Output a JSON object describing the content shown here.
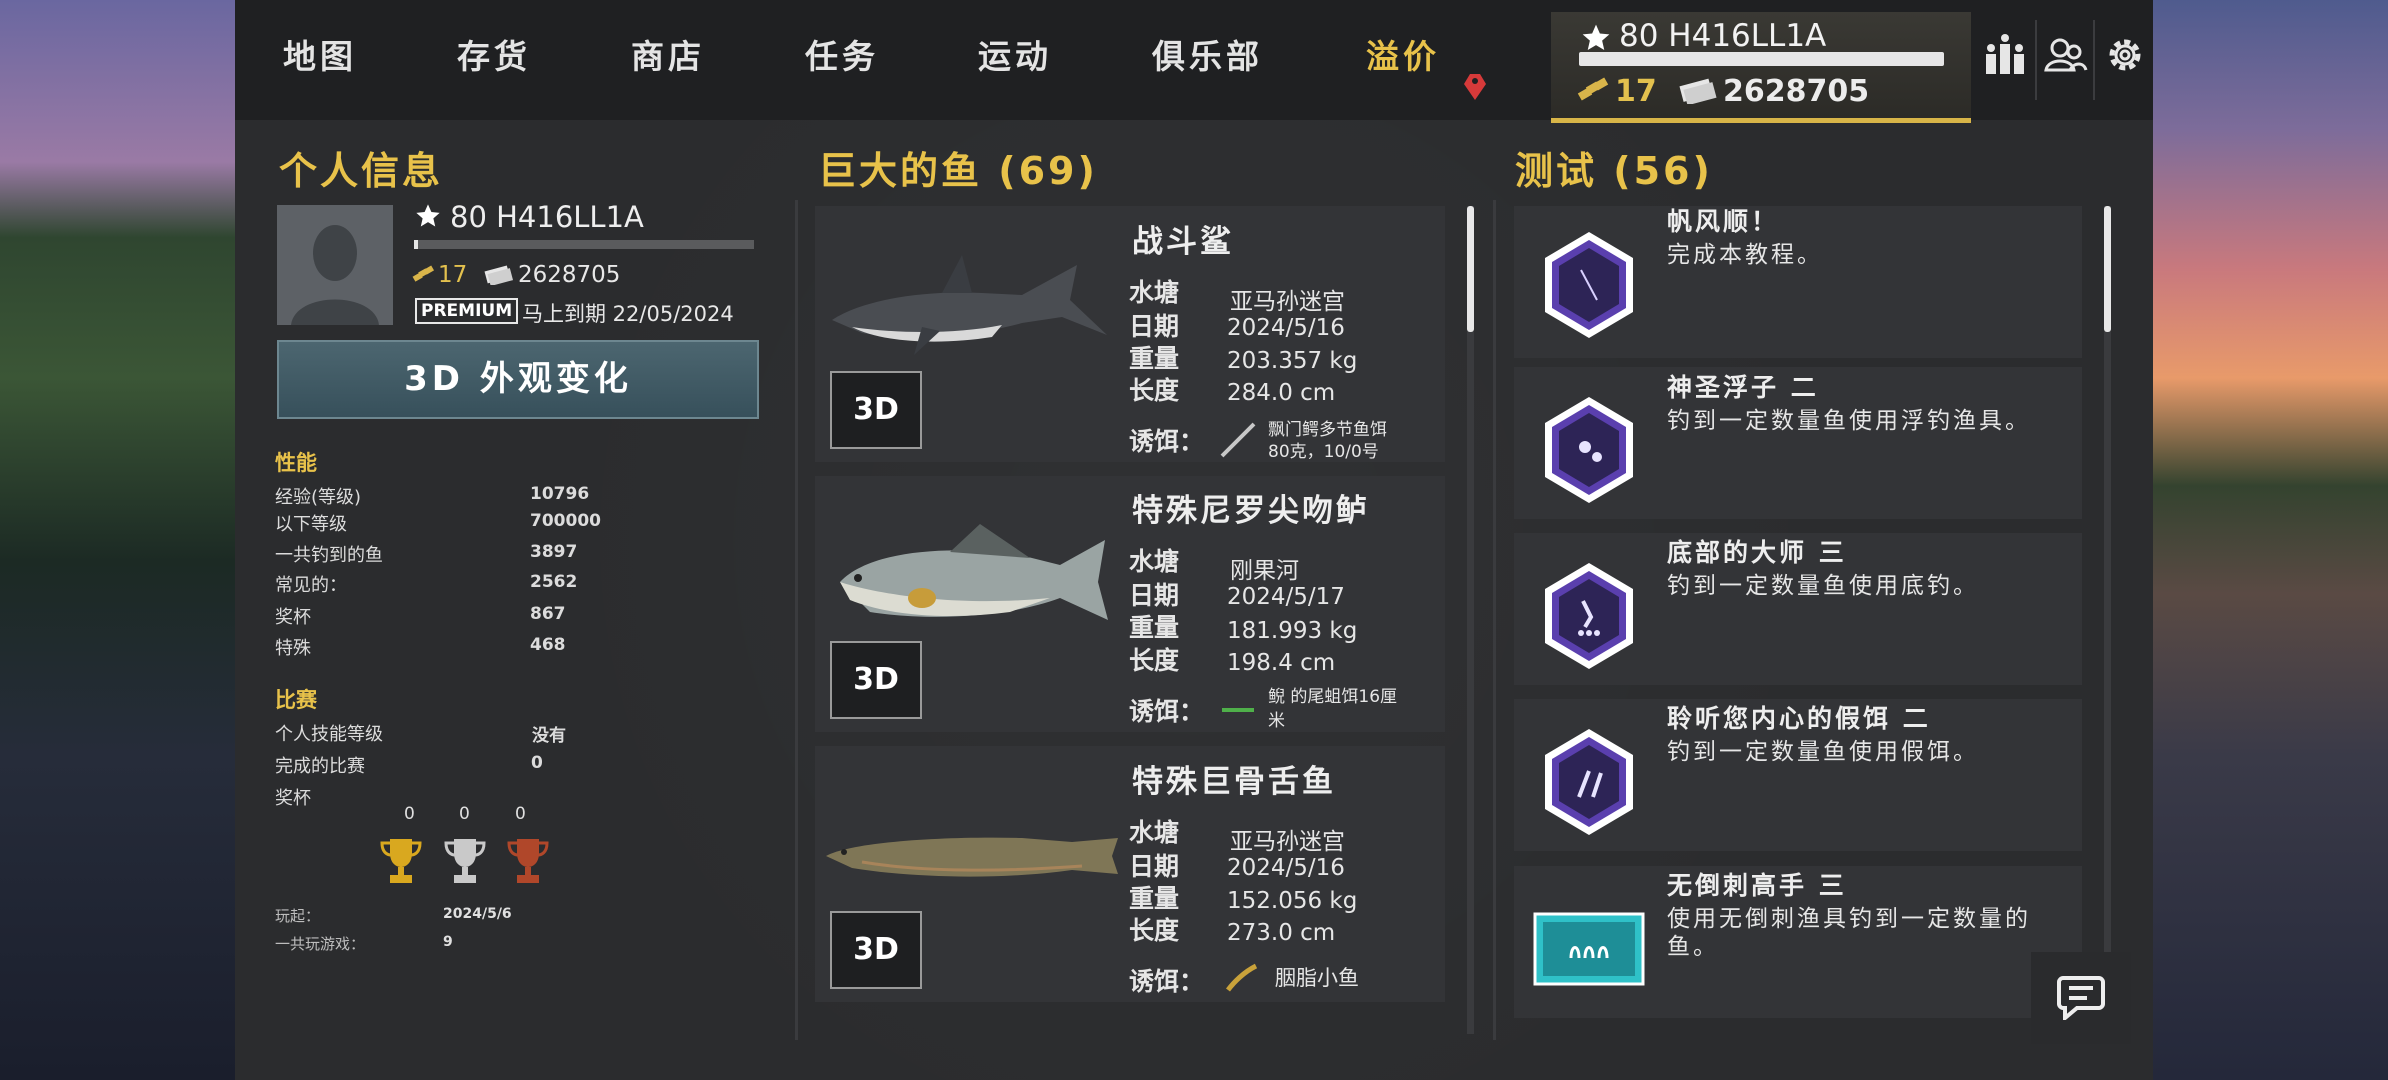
{
  "nav": {
    "items": [
      {
        "label": "地图"
      },
      {
        "label": "存货"
      },
      {
        "label": "商店"
      },
      {
        "label": "任务"
      },
      {
        "label": "运动"
      },
      {
        "label": "俱乐部"
      },
      {
        "label": "溢价",
        "active": true
      }
    ],
    "accent": "#e8c24a"
  },
  "player": {
    "level_name": "80 H416LL1A",
    "gold": "17",
    "cash": "2628705",
    "premium_badge": "PREMIUM",
    "premium_expiry": "马上到期 22/05/2024",
    "appearance_button": "3D 外观变化"
  },
  "profile": {
    "title": "个人信息",
    "performance_title": "性能",
    "stats": [
      {
        "label": "经验(等级)",
        "value": "10796"
      },
      {
        "label": "以下等级",
        "value": "700000"
      },
      {
        "label": "一共钓到的鱼",
        "value": "3897"
      },
      {
        "label": "常见的：",
        "value": "2562"
      },
      {
        "label": "奖杯",
        "value": "867"
      },
      {
        "label": "特殊",
        "value": "468"
      }
    ],
    "competition_title": "比赛",
    "competition": [
      {
        "label": "个人技能等级",
        "value": "没有"
      },
      {
        "label": "完成的比赛",
        "value": "0"
      },
      {
        "label": "奖杯",
        "value": ""
      }
    ],
    "trophies": [
      {
        "count": "0",
        "color": "#d9a81f",
        "icon": "gold-trophy-icon"
      },
      {
        "count": "0",
        "color": "#c9c9c9",
        "icon": "silver-trophy-icon"
      },
      {
        "count": "0",
        "color": "#b0472a",
        "icon": "bronze-trophy-icon"
      }
    ],
    "footer": [
      {
        "label": "玩起：",
        "value": "2024/5/6"
      },
      {
        "label": "一共玩游戏：",
        "value": "9"
      }
    ]
  },
  "fish": {
    "title": "巨大的鱼 (69)",
    "labels": {
      "pond": "水塘",
      "date": "日期",
      "weight": "重量",
      "length": "长度",
      "lure": "诱饵："
    },
    "button_3d": "3D",
    "items": [
      {
        "name": "战斗鲨",
        "pond": "亚马孙迷宫",
        "date": "2024/5/16",
        "weight": "203.357 kg",
        "length": "284.0 cm",
        "lure_line1": "飘门鳄多节鱼饵",
        "lure_line2": "80克，10/0号"
      },
      {
        "name": "特殊尼罗尖吻鲈",
        "pond": "刚果河",
        "date": "2024/5/17",
        "weight": "181.993 kg",
        "length": "198.4 cm",
        "lure_line1": "鲵 的尾蛆饵16厘",
        "lure_line2": "米"
      },
      {
        "name": "特殊巨骨舌鱼",
        "pond": "亚马孙迷宫",
        "date": "2024/5/16",
        "weight": "152.056 kg",
        "length": "273.0 cm",
        "lure_line1": "胭脂小鱼",
        "lure_line2": ""
      }
    ]
  },
  "tests": {
    "title": "测试 (56)",
    "items": [
      {
        "title": "帆风顺！",
        "desc": "完成本教程。",
        "icon": "tutorial-badge-icon"
      },
      {
        "title": "神圣浮子 二",
        "desc": "钓到一定数量鱼使用浮钓渔具。",
        "icon": "float-badge-icon"
      },
      {
        "title": "底部的大师 三",
        "desc": "钓到一定数量鱼使用底钓。",
        "icon": "bottom-badge-icon"
      },
      {
        "title": "聆听您内心的假饵 二",
        "desc": "钓到一定数量鱼使用假饵。",
        "icon": "lure-badge-icon"
      },
      {
        "title": "无倒刺高手 三",
        "desc": "使用无倒刺渔具钓到一定数量的鱼。",
        "icon": "barbless-badge-icon"
      }
    ]
  }
}
